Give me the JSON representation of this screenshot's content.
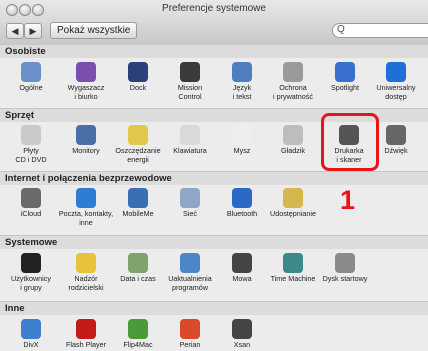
{
  "window": {
    "title": "Preferencje systemowe"
  },
  "toolbar": {
    "show_all": "Pokaż wszystkie",
    "back": "◀",
    "forward": "▶",
    "search_glass": "Q"
  },
  "sections": [
    {
      "title": "Osobiste",
      "items": [
        {
          "label": "Ogólne",
          "icon": "general-icon"
        },
        {
          "label": "Wygaszacz\ni biurko",
          "icon": "desktop-icon"
        },
        {
          "label": "Dock",
          "icon": "dock-icon"
        },
        {
          "label": "Mission\nControl",
          "icon": "mission-control-icon"
        },
        {
          "label": "Język\ni tekst",
          "icon": "language-icon"
        },
        {
          "label": "Ochrona\ni prywatność",
          "icon": "security-icon"
        },
        {
          "label": "Spotlight",
          "icon": "spotlight-icon"
        },
        {
          "label": "Uniwersalny\ndostęp",
          "icon": "accessibility-icon"
        }
      ]
    },
    {
      "title": "Sprzęt",
      "items": [
        {
          "label": "Płyty\nCD i DVD",
          "icon": "cd-icon"
        },
        {
          "label": "Monitory",
          "icon": "display-icon"
        },
        {
          "label": "Oszczędzanie\nenergii",
          "icon": "energy-icon"
        },
        {
          "label": "Klawiatura",
          "icon": "keyboard-icon"
        },
        {
          "label": "Mysz",
          "icon": "mouse-icon"
        },
        {
          "label": "Gładzik",
          "icon": "trackpad-icon"
        },
        {
          "label": "Drukarka\ni skaner",
          "icon": "printer-icon"
        },
        {
          "label": "Dźwięk",
          "icon": "sound-icon"
        }
      ]
    },
    {
      "title": "Internet i połączenia bezprzewodowe",
      "items": [
        {
          "label": "iCloud",
          "icon": "icloud-icon"
        },
        {
          "label": "Poczta, kontakty,\ninne",
          "icon": "mail-icon"
        },
        {
          "label": "MobileMe",
          "icon": "mobileme-icon"
        },
        {
          "label": "Sieć",
          "icon": "network-icon"
        },
        {
          "label": "Bluetooth",
          "icon": "bluetooth-icon"
        },
        {
          "label": "Udostępnianie",
          "icon": "sharing-icon"
        }
      ]
    },
    {
      "title": "Systemowe",
      "items": [
        {
          "label": "Użytkownicy\ni grupy",
          "icon": "users-icon"
        },
        {
          "label": "Nadzór\nrodzicielski",
          "icon": "parental-icon"
        },
        {
          "label": "Data i czas",
          "icon": "clock-icon"
        },
        {
          "label": "Uaktualnienia\nprogramów",
          "icon": "update-icon"
        },
        {
          "label": "Mowa",
          "icon": "speech-icon"
        },
        {
          "label": "Time Machine",
          "icon": "timemachine-icon"
        },
        {
          "label": "Dysk startowy",
          "icon": "startup-disk-icon"
        }
      ]
    },
    {
      "title": "Inne",
      "items": [
        {
          "label": "DivX",
          "icon": "divx-icon"
        },
        {
          "label": "Flash Player",
          "icon": "flash-icon"
        },
        {
          "label": "Flip4Mac",
          "icon": "flip4mac-icon"
        },
        {
          "label": "Perian",
          "icon": "perian-icon"
        },
        {
          "label": "Xsan",
          "icon": "xsan-icon"
        }
      ]
    }
  ],
  "annotation": {
    "number": "1",
    "color": "#e8141b"
  }
}
